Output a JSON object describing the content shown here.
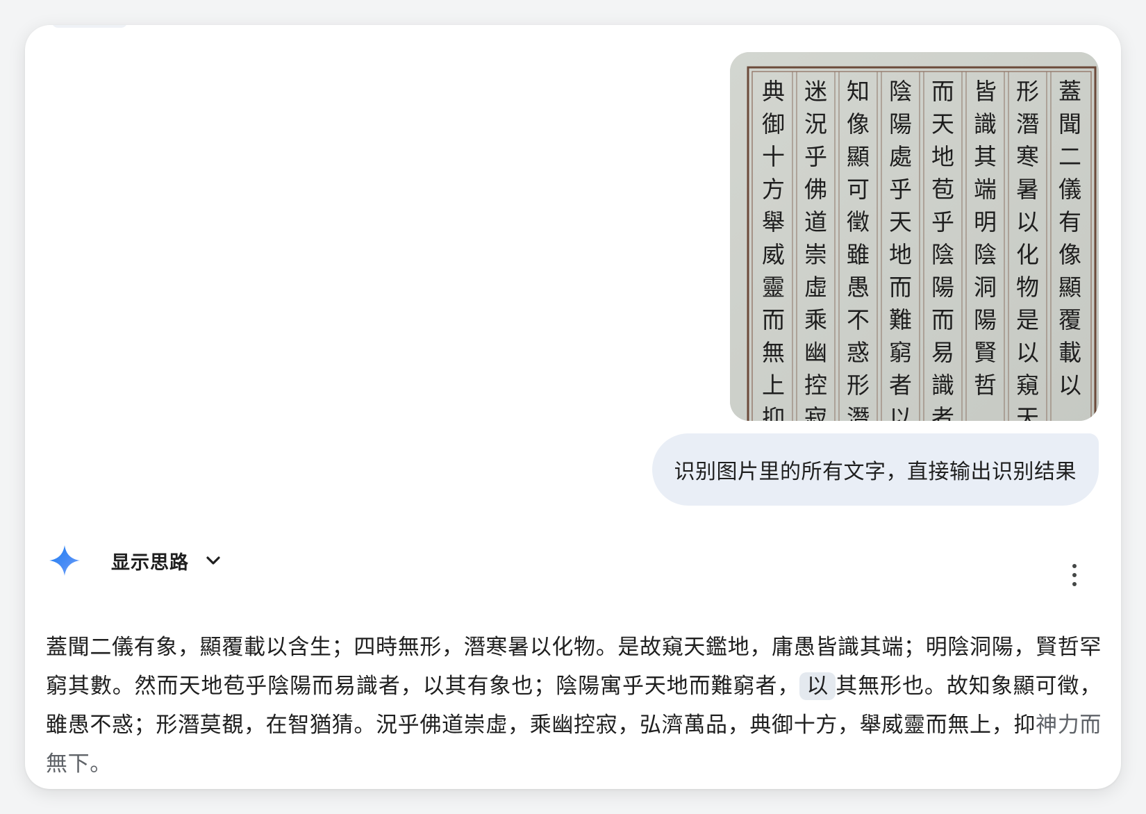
{
  "user_message": {
    "image": {
      "alt": "",
      "columns": [
        "蓋聞二儀有像顯覆載以",
        "形潛寒暑以化物是以窺天",
        "皆識其端明陰洞陽賢哲",
        "而天地苞乎陰陽而易識者",
        "陰陽處乎天地而難窮者以",
        "知像顯可徵雖愚不惑形潛莫",
        "迷況乎佛道崇虛乘幽控寂",
        "典御十方舉威靈而無上抑"
      ]
    },
    "text": "识别图片里的所有文字，直接输出识别结果"
  },
  "response": {
    "thinking_toggle_label": "显示思路",
    "answer_part1": "蓋聞二儀有象，顯覆載以含生；四時無形，潛寒暑以化物。是故窺天鑑地，庸愚皆識其端；明陰洞陽，賢哲罕窮其數。然而天地苞乎陰陽而易識者，以其有象也；陰陽寓乎天地而難窮者，",
    "answer_highlight": "以",
    "answer_part2": "其無形也。故知象顯可徵，雖愚不惑；形潛莫覩，在智猶猜。況乎佛道崇虛，乘幽控寂，弘濟萬品，典御十方，舉威靈而無上，抑",
    "answer_tail": "神力而無下。"
  },
  "colors": {
    "bubble": "#e9eef6",
    "gemini_blue": "#4285f4",
    "text": "#1f1f1f"
  }
}
